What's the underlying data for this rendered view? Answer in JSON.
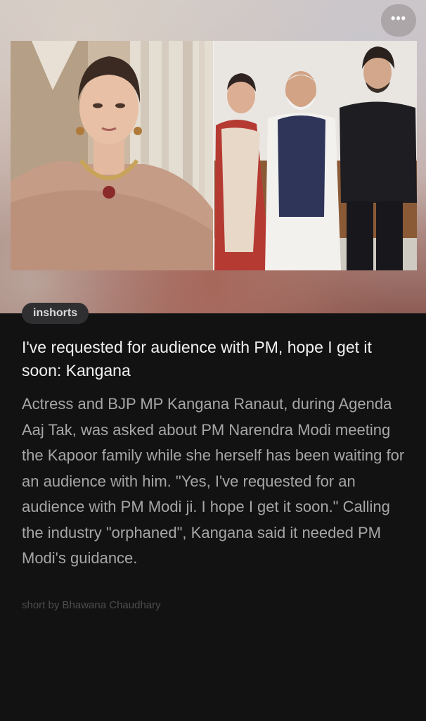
{
  "header": {
    "menu_label": "•••"
  },
  "card": {
    "brand": "inshorts",
    "headline": "I've requested for audience with PM, hope I get it soon: Kangana",
    "body": "Actress and BJP MP Kangana Ranaut, during Agenda Aaj Tak, was asked about PM Narendra Modi meeting the Kapoor family while she herself has been waiting for an audience with him. \"Yes, I've requested for an audience with PM Modi ji. I hope I get it soon.\" Calling the industry \"orphaned\", Kangana said it needed PM Modi's guidance.",
    "byline": "short by Bhawana Chaudhary"
  },
  "colors": {
    "background": "#121212",
    "headline": "#f2f2f2",
    "body": "#a6a6a6",
    "byline": "#4d4d4d",
    "brand_pill": "#2f2f31"
  }
}
